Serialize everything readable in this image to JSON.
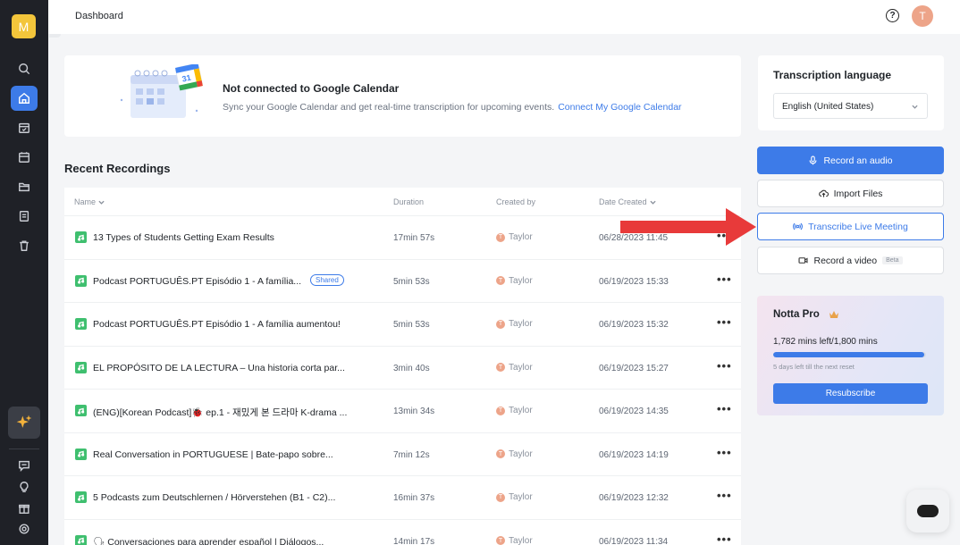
{
  "app": {
    "workspace_initial": "M",
    "page_title": "Dashboard",
    "user_initial": "T",
    "help_icon_glyph": "?"
  },
  "sidebar": {
    "items": [
      {
        "icon": "search-icon"
      },
      {
        "icon": "home-icon",
        "active": true
      },
      {
        "icon": "calendar-check-icon"
      },
      {
        "icon": "calendar-icon"
      },
      {
        "icon": "folder-icon"
      },
      {
        "icon": "document-icon"
      },
      {
        "icon": "trash-icon"
      }
    ],
    "bottom_items": [
      {
        "icon": "feedback-icon"
      },
      {
        "icon": "lightbulb-icon"
      },
      {
        "icon": "gift-icon"
      },
      {
        "icon": "settings-icon"
      }
    ]
  },
  "calendar_banner": {
    "title": "Not connected to Google Calendar",
    "description": "Sync your Google Calendar and get real-time transcription for upcoming events.",
    "link": "Connect My Google Calendar",
    "calendar_number": "31"
  },
  "recordings": {
    "title": "Recent Recordings",
    "columns": {
      "name": "Name",
      "duration": "Duration",
      "created_by": "Created by",
      "date_created": "Date Created"
    },
    "rows": [
      {
        "name": "13 Types of Students Getting Exam Results",
        "duration": "17min 57s",
        "owner_initial": "T",
        "owner": "Taylor",
        "date": "06/28/2023 11:45",
        "more": "•••"
      },
      {
        "name": "Podcast PORTUGUÊS.PT Episódio 1 - A família...",
        "badge": "Shared",
        "duration": "5min 53s",
        "owner_initial": "T",
        "owner": "Taylor",
        "date": "06/19/2023 15:33",
        "more": "•••"
      },
      {
        "name": "Podcast PORTUGUÊS.PT Episódio 1 - A família aumentou!",
        "duration": "5min 53s",
        "owner_initial": "T",
        "owner": "Taylor",
        "date": "06/19/2023 15:32",
        "more": "•••"
      },
      {
        "name": "EL PROPÓSITO DE LA LECTURA – Una historia corta par...",
        "duration": "3min 40s",
        "owner_initial": "T",
        "owner": "Taylor",
        "date": "06/19/2023 15:27",
        "more": "•••"
      },
      {
        "name": "(ENG)[Korean Podcast]🐞 ep.1 - 재밌게 본 드라마 K-drama ...",
        "duration": "13min 34s",
        "owner_initial": "T",
        "owner": "Taylor",
        "date": "06/19/2023 14:35",
        "more": "•••"
      },
      {
        "name": "Real Conversation in PORTUGUESE | Bate-papo sobre...",
        "duration": "7min 12s",
        "owner_initial": "T",
        "owner": "Taylor",
        "date": "06/19/2023 14:19",
        "more": "•••"
      },
      {
        "name": "5 Podcasts zum Deutschlernen / Hörverstehen (B1 - C2)...",
        "duration": "16min 37s",
        "owner_initial": "T",
        "owner": "Taylor",
        "date": "06/19/2023 12:32",
        "more": "•••"
      },
      {
        "name": "🗣 Conversaciones para aprender español | Diálogos...",
        "duration": "14min 17s",
        "owner_initial": "T",
        "owner": "Taylor",
        "date": "06/19/2023 11:34",
        "more": "•••"
      }
    ]
  },
  "transcription_language": {
    "title": "Transcription language",
    "value": "English (United States)"
  },
  "actions": {
    "record_audio": "Record an audio",
    "import_files": "Import Files",
    "transcribe_live": "Transcribe Live Meeting",
    "record_video": "Record a video",
    "beta": "Beta"
  },
  "pro": {
    "title": "Notta Pro",
    "usage": "1,782 mins left/1,800 mins",
    "usage_fraction": 0.99,
    "reset_note": "5 days left till the next reset",
    "resubscribe": "Resubscribe"
  },
  "colors": {
    "accent": "#3d7be8",
    "sidebar": "#1f2127",
    "file_icon": "#3fbf6f",
    "arrow": "#e83a3a",
    "workspace": "#f3c53b",
    "avatar": "#eda489"
  }
}
